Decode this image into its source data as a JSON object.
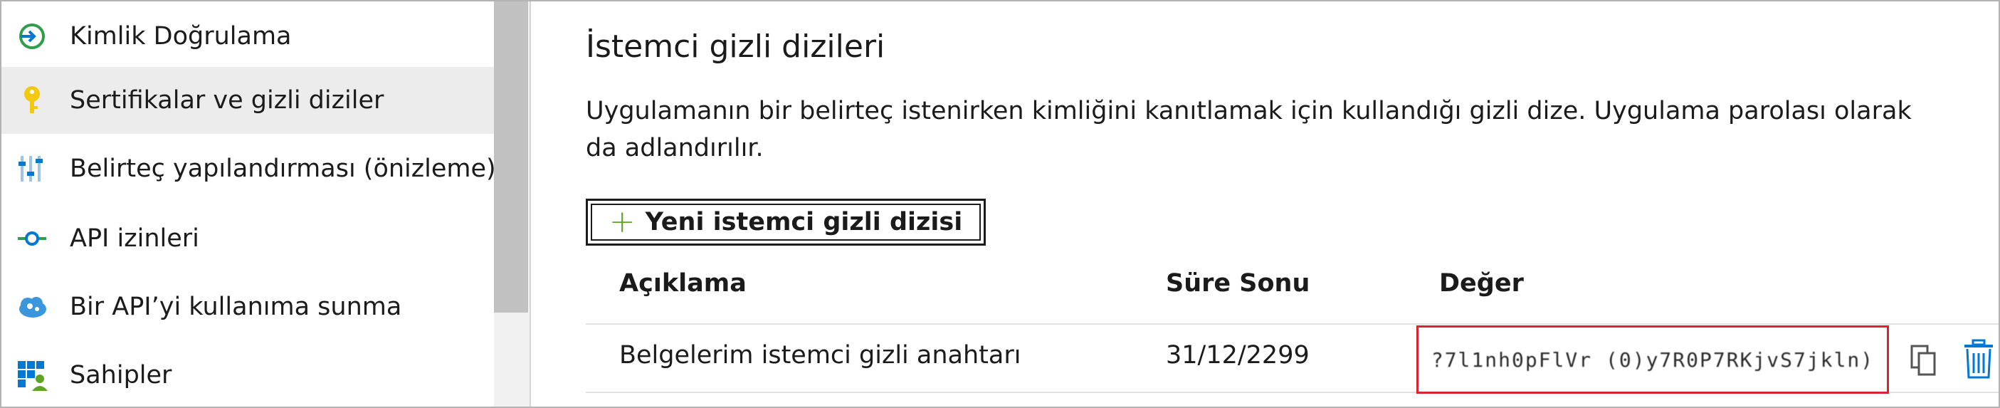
{
  "sidebar": {
    "items": [
      {
        "label": "Kimlik Doğrulama",
        "icon": "authentication-icon",
        "selected": false
      },
      {
        "label": "Sertifikalar ve gizli diziler",
        "icon": "key-icon",
        "selected": true
      },
      {
        "label": "Belirteç yapılandırması (önizleme)",
        "icon": "token-config-icon",
        "selected": false
      },
      {
        "label": "API izinleri",
        "icon": "api-permissions-icon",
        "selected": false
      },
      {
        "label": "Bir API’yi kullanıma sunma",
        "icon": "expose-api-icon",
        "selected": false
      },
      {
        "label": "Sahipler",
        "icon": "owners-icon",
        "selected": false
      }
    ]
  },
  "main": {
    "title": "İstemci gizli dizileri",
    "description": "Uygulamanın bir belirteç istenirken kimliğini kanıtlamak için kullandığı gizli dize. Uygulama parolası olarak da adlandırılır.",
    "new_button_label": "Yeni istemci gizli dizisi",
    "table": {
      "headers": {
        "description": "Açıklama",
        "expires": "Süre Sonu",
        "value": "Değer"
      },
      "rows": [
        {
          "description": "Belgelerim istemci gizli anahtarı",
          "expires": "31/12/2299",
          "value": "?7l1nh0pFlVr (0)y7R0P7RKjvS7jkln)"
        }
      ]
    }
  },
  "colors": {
    "highlight_border": "#d9232e",
    "selected_bg": "#ececec",
    "accent_green": "#5ea425",
    "accent_blue": "#0078d4"
  }
}
